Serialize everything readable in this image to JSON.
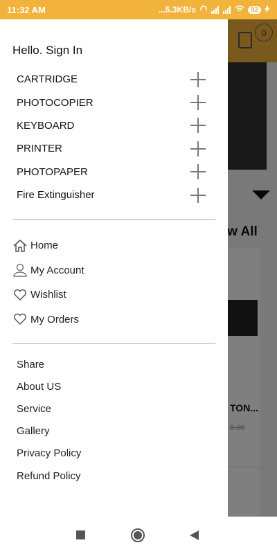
{
  "status_bar": {
    "time": "11:32 AM",
    "network_speed": "...5.3KB/s",
    "battery": "92"
  },
  "background": {
    "cart_count": "0",
    "view_all": "View All",
    "product_title": "TON...",
    "product_price": "0.00"
  },
  "drawer": {
    "greeting": "Hello. Sign In",
    "categories": [
      {
        "label": "CARTRIDGE"
      },
      {
        "label": "PHOTOCOPIER"
      },
      {
        "label": "KEYBOARD"
      },
      {
        "label": "PRINTER"
      },
      {
        "label": "PHOTOPAPER"
      },
      {
        "label": "Fire Extinguisher"
      }
    ],
    "nav_items": [
      {
        "label": "Home",
        "icon": "home-icon"
      },
      {
        "label": "My Account",
        "icon": "user-icon"
      },
      {
        "label": "Wishlist",
        "icon": "heart-icon"
      },
      {
        "label": "My Orders",
        "icon": "heart-icon"
      }
    ],
    "links": [
      {
        "label": "Share"
      },
      {
        "label": "About US"
      },
      {
        "label": "Service"
      },
      {
        "label": "Gallery"
      },
      {
        "label": "Privacy Policy"
      },
      {
        "label": "Refund Policy"
      }
    ]
  },
  "colors": {
    "accent": "#f2b33d",
    "icon_gray": "#777777"
  }
}
